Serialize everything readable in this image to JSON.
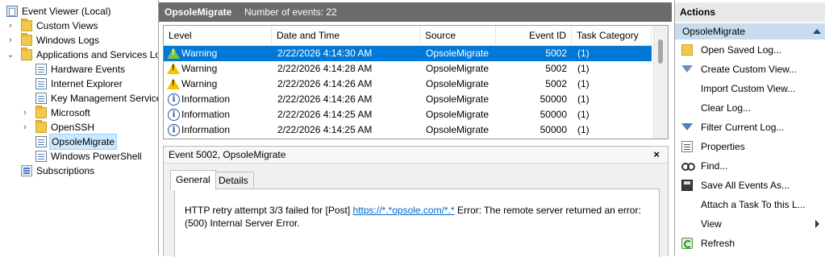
{
  "tree": {
    "items": [
      {
        "label": "Event Viewer (Local)",
        "icon": "event-viewer-icon",
        "arrow": "",
        "selected": false
      },
      {
        "label": "Custom Views",
        "icon": "folder-icon",
        "arrow": "›",
        "selected": false
      },
      {
        "label": "Windows Logs",
        "icon": "folder-icon",
        "arrow": "›",
        "selected": false
      },
      {
        "label": "Applications and Services Lo",
        "icon": "folder-icon",
        "arrow": "⌄",
        "selected": false
      },
      {
        "label": "Hardware Events",
        "icon": "log-icon",
        "arrow": "",
        "selected": false
      },
      {
        "label": "Internet Explorer",
        "icon": "log-icon",
        "arrow": "",
        "selected": false
      },
      {
        "label": "Key Management Service",
        "icon": "log-icon",
        "arrow": "",
        "selected": false
      },
      {
        "label": "Microsoft",
        "icon": "folder-icon",
        "arrow": "›",
        "selected": false
      },
      {
        "label": "OpenSSH",
        "icon": "folder-icon",
        "arrow": "›",
        "selected": false
      },
      {
        "label": "OpsoleMigrate",
        "icon": "log-icon",
        "arrow": "",
        "selected": true
      },
      {
        "label": "Windows PowerShell",
        "icon": "log-icon",
        "arrow": "",
        "selected": false
      },
      {
        "label": "Subscriptions",
        "icon": "subscriptions-icon",
        "arrow": "",
        "selected": false
      }
    ]
  },
  "center": {
    "log_name": "OpsoleMigrate",
    "event_count": "Number of events: 22"
  },
  "grid": {
    "columns": [
      "Level",
      "Date and Time",
      "Source",
      "Event ID",
      "Task Category"
    ],
    "rows": [
      {
        "level": "Warning",
        "type": "warning",
        "datetime": "2/22/2026 4:14:30 AM",
        "source": "OpsoleMigrate",
        "event_id": "5002",
        "task": "(1)",
        "selected": true
      },
      {
        "level": "Warning",
        "type": "warning",
        "datetime": "2/22/2026 4:14:28 AM",
        "source": "OpsoleMigrate",
        "event_id": "5002",
        "task": "(1)",
        "selected": false
      },
      {
        "level": "Warning",
        "type": "warning",
        "datetime": "2/22/2026 4:14:26 AM",
        "source": "OpsoleMigrate",
        "event_id": "5002",
        "task": "(1)",
        "selected": false
      },
      {
        "level": "Information",
        "type": "info",
        "datetime": "2/22/2026 4:14:26 AM",
        "source": "OpsoleMigrate",
        "event_id": "50000",
        "task": "(1)",
        "selected": false
      },
      {
        "level": "Information",
        "type": "info",
        "datetime": "2/22/2026 4:14:25 AM",
        "source": "OpsoleMigrate",
        "event_id": "50000",
        "task": "(1)",
        "selected": false
      },
      {
        "level": "Information",
        "type": "info",
        "datetime": "2/22/2026 4:14:25 AM",
        "source": "OpsoleMigrate",
        "event_id": "50000",
        "task": "(1)",
        "selected": false
      }
    ]
  },
  "detail": {
    "title": "Event 5002, OpsoleMigrate",
    "close": "×",
    "tabs": [
      "General",
      "Details"
    ],
    "message_pre": "HTTP retry attempt 3/3 failed for [Post] ",
    "message_link": "https://*.*opsole.com/*.*",
    "message_post": " Error: The remote server returned an error: (500) Internal Server Error."
  },
  "actions": {
    "header": "Actions",
    "section": "OpsoleMigrate",
    "items": [
      {
        "label": "Open Saved Log...",
        "icon": "open-folder-icon"
      },
      {
        "label": "Create Custom View...",
        "icon": "funnel-icon"
      },
      {
        "label": "Import Custom View...",
        "icon": ""
      },
      {
        "label": "Clear Log...",
        "icon": ""
      },
      {
        "label": "Filter Current Log...",
        "icon": "filter-icon"
      },
      {
        "label": "Properties",
        "icon": "properties-icon"
      },
      {
        "label": "Find...",
        "icon": "binoculars-icon"
      },
      {
        "label": "Save All Events As...",
        "icon": "save-icon"
      },
      {
        "label": "Attach a Task To this L...",
        "icon": ""
      },
      {
        "label": "View",
        "icon": "",
        "submenu": true
      },
      {
        "label": "Refresh",
        "icon": "refresh-icon"
      }
    ]
  }
}
